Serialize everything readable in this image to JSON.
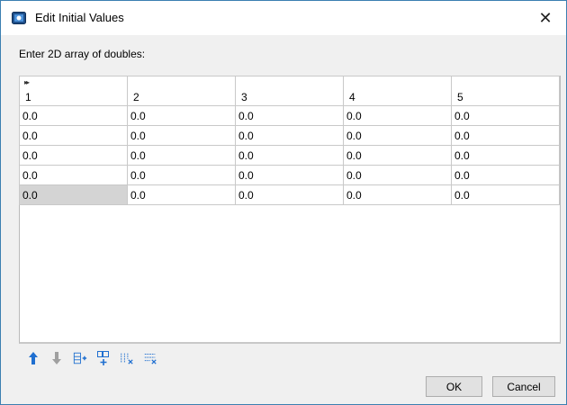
{
  "window": {
    "title": "Edit Initial Values",
    "close_glyph": "✕"
  },
  "prompt": "Enter 2D array of doubles:",
  "table": {
    "columns": [
      "1",
      "2",
      "3",
      "4",
      "5"
    ],
    "rows": [
      [
        "0.0",
        "0.0",
        "0.0",
        "0.0",
        "0.0"
      ],
      [
        "0.0",
        "0.0",
        "0.0",
        "0.0",
        "0.0"
      ],
      [
        "0.0",
        "0.0",
        "0.0",
        "0.0",
        "0.0"
      ],
      [
        "0.0",
        "0.0",
        "0.0",
        "0.0",
        "0.0"
      ],
      [
        "0.0",
        "0.0",
        "0.0",
        "0.0",
        "0.0"
      ]
    ],
    "selected_cell": {
      "row": 4,
      "col": 0
    }
  },
  "toolbar": {
    "icons": [
      "move-up-icon",
      "move-down-icon",
      "add-row-icon",
      "insert-row-icon",
      "delete-column-icon",
      "clear-rows-icon"
    ]
  },
  "buttons": {
    "ok": "OK",
    "cancel": "Cancel"
  },
  "colors": {
    "accent": "#1f6fd0",
    "selected_cell": "#d4d4d4",
    "window_border": "#3c7fb1"
  }
}
